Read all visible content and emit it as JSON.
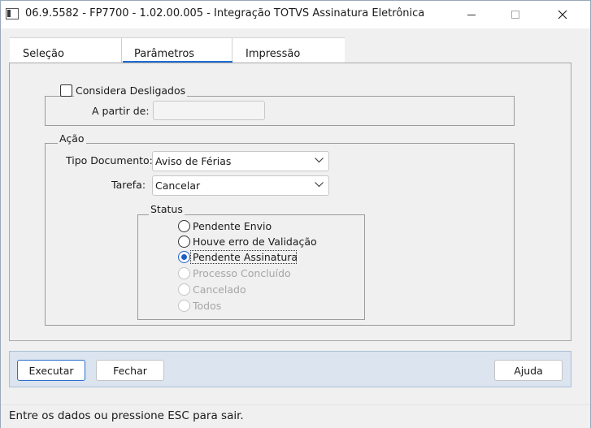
{
  "window": {
    "title": "06.9.5582 - FP7700 - 1.02.00.005 - Integração TOTVS Assinatura Eletrônica",
    "icons": {
      "app": "app-window-icon",
      "minimize": "minimize-icon",
      "maximize": "maximize-icon",
      "close": "close-icon"
    }
  },
  "tabs": [
    {
      "label": "Seleção",
      "active": false
    },
    {
      "label": "Parâmetros",
      "active": true
    },
    {
      "label": "Impressão",
      "active": false
    }
  ],
  "desligados": {
    "checkbox_label": "Considera Desligados",
    "checked": false,
    "a_partir_label": "A partir de:",
    "a_partir_value": ""
  },
  "acao": {
    "title": "Ação",
    "tipo_label": "Tipo Documento:",
    "tipo_value": "Aviso de Férias",
    "tarefa_label": "Tarefa:",
    "tarefa_value": "Cancelar"
  },
  "status": {
    "title": "Status",
    "options": [
      {
        "label": "Pendente Envio",
        "checked": false,
        "enabled": true
      },
      {
        "label": "Houve erro de Validação",
        "checked": false,
        "enabled": true
      },
      {
        "label": "Pendente Assinatura",
        "checked": true,
        "enabled": true
      },
      {
        "label": "Processo Concluído",
        "checked": false,
        "enabled": false
      },
      {
        "label": "Cancelado",
        "checked": false,
        "enabled": false
      },
      {
        "label": "Todos",
        "checked": false,
        "enabled": false
      }
    ]
  },
  "buttons": {
    "executar": "Executar",
    "fechar": "Fechar",
    "ajuda": "Ajuda"
  },
  "statusbar": {
    "message": "Entre os dados ou pressione ESC para sair."
  },
  "colors": {
    "accent": "#1f6fd1",
    "buttonbar": "#dbe4ef"
  }
}
